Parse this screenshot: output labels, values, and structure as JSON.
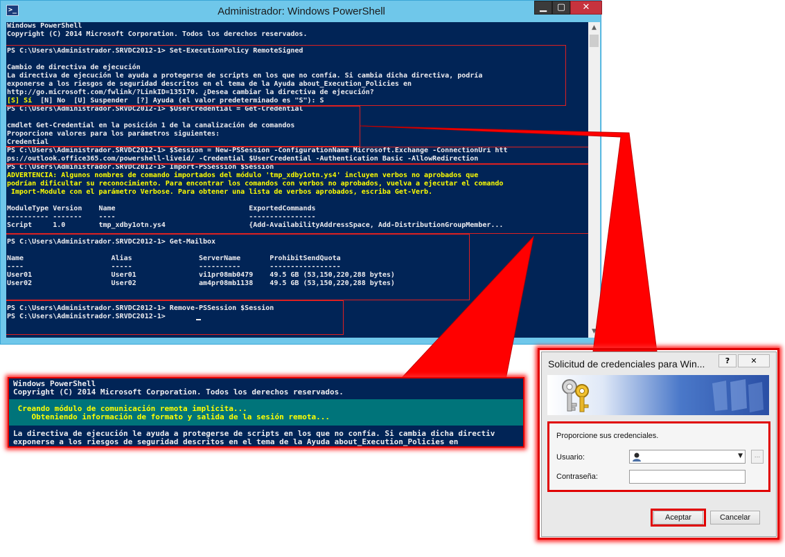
{
  "window": {
    "title": "Administrador: Windows PowerShell",
    "app_icon_glyph": ">_",
    "controls": {
      "minimize": "▁",
      "maximize": "▢",
      "close": "✕"
    }
  },
  "console": {
    "lines": [
      {
        "text": "Windows PowerShell"
      },
      {
        "text": "Copyright (C) 2014 Microsoft Corporation. Todos los derechos reservados."
      },
      {
        "text": ""
      },
      {
        "text": "PS C:\\Users\\Administrador.SRVDC2012-1> Set-ExecutionPolicy RemoteSigned"
      },
      {
        "text": ""
      },
      {
        "text": "Cambio de directiva de ejecución"
      },
      {
        "text": "La directiva de ejecución le ayuda a protegerse de scripts en los que no confía. Si cambia dicha directiva, podría"
      },
      {
        "text": "exponerse a los riesgos de seguridad descritos en el tema de la Ayuda about_Execution_Policies en"
      },
      {
        "text": "http://go.microsoft.com/fwlink/?LinkID=135170. ¿Desea cambiar la directiva de ejecución?"
      },
      {
        "text": "[S] Sí  [N] No  [U] Suspender  [?] Ayuda (el valor predeterminado es \"S\"): S",
        "color": "mixed"
      },
      {
        "text": "PS C:\\Users\\Administrador.SRVDC2012-1> $UserCredential = Get-Credential"
      },
      {
        "text": ""
      },
      {
        "text": "cmdlet Get-Credential en la posición 1 de la canalización de comandos"
      },
      {
        "text": "Proporcione valores para los parámetros siguientes:"
      },
      {
        "text": "Credential"
      },
      {
        "text": "PS C:\\Users\\Administrador.SRVDC2012-1> $Session = New-PSSession -ConfigurationName Microsoft.Exchange -ConnectionUri htt"
      },
      {
        "text": "ps://outlook.office365.com/powershell-liveid/ -Credential $UserCredential -Authentication Basic -AllowRedirection"
      },
      {
        "text": "PS C:\\Users\\Administrador.SRVDC2012-1> Import-PSSession $Session"
      },
      {
        "text": "ADVERTENCIA: Algunos nombres de comando importados del módulo 'tmp_xdby1otn.ys4' incluyen verbos no aprobados que",
        "color": "yellow"
      },
      {
        "text": "podrían dificultar su reconocimiento. Para encontrar los comandos con verbos no aprobados, vuelva a ejecutar el comando",
        "color": "yellow"
      },
      {
        "text": " Import-Module con el parámetro Verbose. Para obtener una lista de verbos aprobados, escriba Get-Verb.",
        "color": "yellow"
      },
      {
        "text": ""
      },
      {
        "text": "ModuleType Version    Name                                ExportedCommands"
      },
      {
        "text": "---------- -------    ----                                ----------------"
      },
      {
        "text": "Script     1.0        tmp_xdby1otn.ys4                    {Add-AvailabilityAddressSpace, Add-DistributionGroupMember..."
      },
      {
        "text": ""
      },
      {
        "text": "PS C:\\Users\\Administrador.SRVDC2012-1> Get-Mailbox"
      },
      {
        "text": ""
      },
      {
        "text": "Name                     Alias                ServerName       ProhibitSendQuota"
      },
      {
        "text": "----                     -----                ----------       -----------------"
      },
      {
        "text": "User01                   User01               vi1pr08mb0479    49.5 GB (53,150,220,288 bytes)"
      },
      {
        "text": "User02                   User02               am4pr08mb1138    49.5 GB (53,150,220,288 bytes)"
      },
      {
        "text": ""
      },
      {
        "text": ""
      },
      {
        "text": "PS C:\\Users\\Administrador.SRVDC2012-1> Remove-PSSession $Session"
      },
      {
        "text": "PS C:\\Users\\Administrador.SRVDC2012-1> "
      }
    ],
    "choice_prefix": "[S] Sí",
    "choice_rest": "  [N] No  [U] Suspender  [?] Ayuda (el valor predeterminado es \"S\"): S"
  },
  "zoom": {
    "lines": [
      {
        "text": "Windows PowerShell"
      },
      {
        "text": "Copyright (C) 2014 Microsoft Corporation. Todos los derechos reservados."
      },
      {
        "text": ""
      },
      {
        "text": " Creando módulo de comunicación remota implícita...",
        "color": "yellow"
      },
      {
        "text": "    Obteniendo información de formato y salida de la sesión remota...",
        "color": "yellow"
      },
      {
        "text": ""
      },
      {
        "text": "La directiva de ejecución le ayuda a protegerse de scripts en los que no confía. Si cambia dicha directiv"
      },
      {
        "text": "exponerse a los riesgos de seguridad descritos en el tema de la Ayuda about_Execution_Policies en"
      }
    ]
  },
  "dialog": {
    "title": "Solicitud de credenciales para Win...",
    "help": "?",
    "close": "✕",
    "prompt": "Proporcione sus credenciales.",
    "user_label": "Usuario:",
    "user_value": "",
    "browse": "...",
    "password_label": "Contraseña:",
    "password_value": "",
    "ok": "Aceptar",
    "cancel": "Cancelar"
  },
  "colors": {
    "console_bg": "#012456",
    "console_fg": "#eeedf0",
    "warning": "#ffff00",
    "titlebar": "#6fc7ea",
    "highlight": "#e00000"
  }
}
